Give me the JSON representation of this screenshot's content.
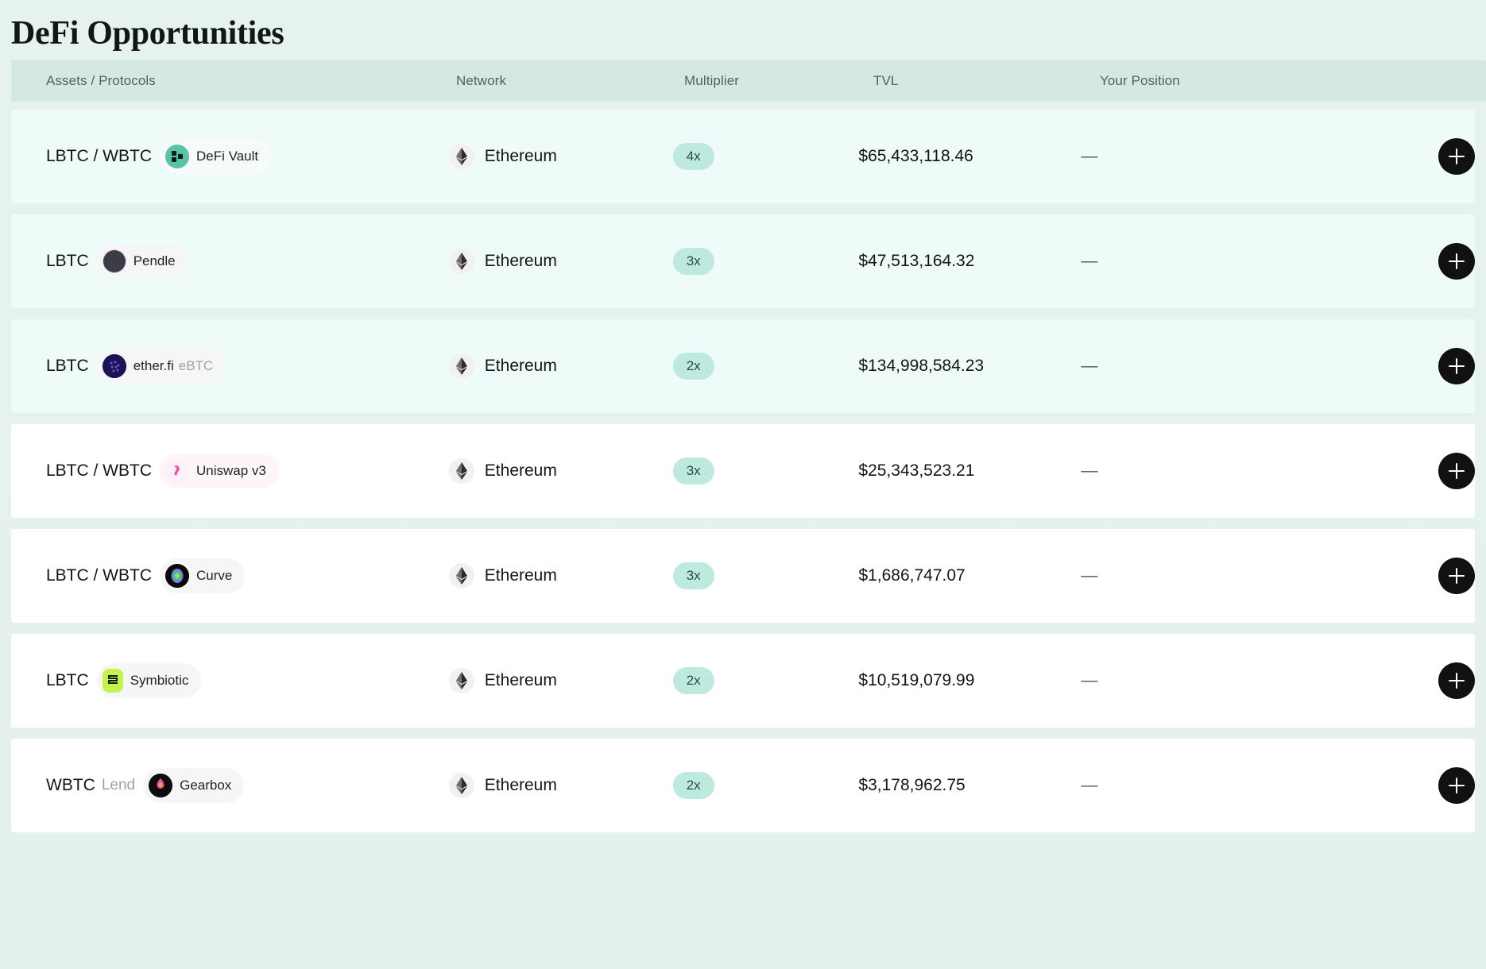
{
  "header": {
    "title": "DeFi Opportunities"
  },
  "table": {
    "columns": [
      {
        "key": "assets",
        "label": "Assets / Protocols"
      },
      {
        "key": "network",
        "label": "Network"
      },
      {
        "key": "mult",
        "label": "Multiplier"
      },
      {
        "key": "tvl",
        "label": "TVL"
      },
      {
        "key": "position",
        "label": "Your Position"
      }
    ],
    "rows": [
      {
        "asset": "LBTC / WBTC",
        "asset_suffix": "",
        "protocol": "DeFi Vault",
        "protocol_suffix": "",
        "protocol_icon": "defi-vault-icon",
        "network": "Ethereum",
        "network_icon": "ethereum-icon",
        "multiplier": "4x",
        "tvl": "$65,433,118.46",
        "position": "—",
        "action": "add-position-button",
        "tinted": true
      },
      {
        "asset": "LBTC",
        "asset_suffix": "",
        "protocol": "Pendle",
        "protocol_suffix": "",
        "protocol_icon": "pendle-icon",
        "network": "Ethereum",
        "network_icon": "ethereum-icon",
        "multiplier": "3x",
        "tvl": "$47,513,164.32",
        "position": "—",
        "action": "add-position-button",
        "tinted": true
      },
      {
        "asset": "LBTC",
        "asset_suffix": "",
        "protocol": "ether.fi",
        "protocol_suffix": "eBTC",
        "protocol_icon": "etherfi-icon",
        "network": "Ethereum",
        "network_icon": "ethereum-icon",
        "multiplier": "2x",
        "tvl": "$134,998,584.23",
        "position": "—",
        "action": "add-position-button",
        "tinted": true
      },
      {
        "asset": "LBTC / WBTC",
        "asset_suffix": "",
        "protocol": "Uniswap v3",
        "protocol_suffix": "",
        "protocol_icon": "uniswap-icon",
        "network": "Ethereum",
        "network_icon": "ethereum-icon",
        "multiplier": "3x",
        "tvl": "$25,343,523.21",
        "position": "—",
        "action": "add-position-button",
        "tinted": false
      },
      {
        "asset": "LBTC / WBTC",
        "asset_suffix": "",
        "protocol": "Curve",
        "protocol_suffix": "",
        "protocol_icon": "curve-icon",
        "network": "Ethereum",
        "network_icon": "ethereum-icon",
        "multiplier": "3x",
        "tvl": "$1,686,747.07",
        "position": "—",
        "action": "add-position-button",
        "tinted": false
      },
      {
        "asset": "LBTC",
        "asset_suffix": "",
        "protocol": "Symbiotic",
        "protocol_suffix": "",
        "protocol_icon": "symbiotic-icon",
        "network": "Ethereum",
        "network_icon": "ethereum-icon",
        "multiplier": "2x",
        "tvl": "$10,519,079.99",
        "position": "—",
        "action": "add-position-button",
        "tinted": false
      },
      {
        "asset": "WBTC",
        "asset_suffix": "Lend",
        "protocol": "Gearbox",
        "protocol_suffix": "",
        "protocol_icon": "gearbox-icon",
        "network": "Ethereum",
        "network_icon": "ethereum-icon",
        "multiplier": "2x",
        "tvl": "$3,178,962.75",
        "position": "—",
        "action": "add-position-button",
        "tinted": false
      }
    ]
  },
  "colors": {
    "page_background": "#e4f1ee",
    "header_background": "#d4e9e4",
    "row_tinted": "#eefbf8",
    "row_plain": "#ffffff",
    "multiplier_badge": "#bde9df",
    "action_button": "#111111"
  }
}
